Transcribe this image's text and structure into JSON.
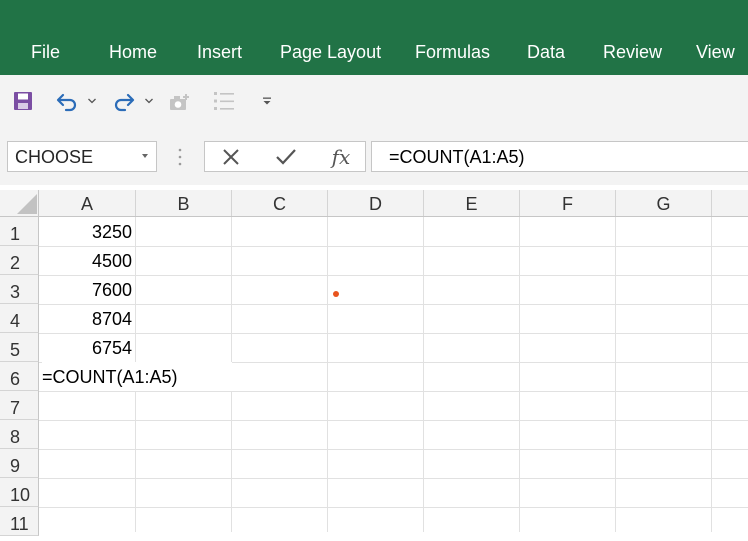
{
  "ribbon": {
    "tabs": [
      "File",
      "Home",
      "Insert",
      "Page Layout",
      "Formulas",
      "Data",
      "Review",
      "View"
    ],
    "color": "#217346"
  },
  "quick_access": {
    "icons": [
      "save-icon",
      "undo-icon",
      "undo-dropdown-icon",
      "redo-icon",
      "redo-dropdown-icon",
      "camera-icon",
      "list-icon",
      "customize-toolbar-icon"
    ]
  },
  "formula_bar": {
    "name_box": "CHOOSE",
    "cancel_icon": "close-icon",
    "enter_icon": "check-icon",
    "fx_label": "fx",
    "formula": "=COUNT(A1:A5)"
  },
  "grid": {
    "columns": [
      "A",
      "B",
      "C",
      "D",
      "E",
      "F",
      "G"
    ],
    "rows": [
      "1",
      "2",
      "3",
      "4",
      "5",
      "6",
      "7",
      "8",
      "9",
      "10",
      "11"
    ],
    "cells": {
      "A1": "3250",
      "A2": "4500",
      "A3": "7600",
      "A4": "8704",
      "A5": "6754",
      "A6": "=COUNT(A1:A5)"
    },
    "marker_color": "#e8541e"
  }
}
